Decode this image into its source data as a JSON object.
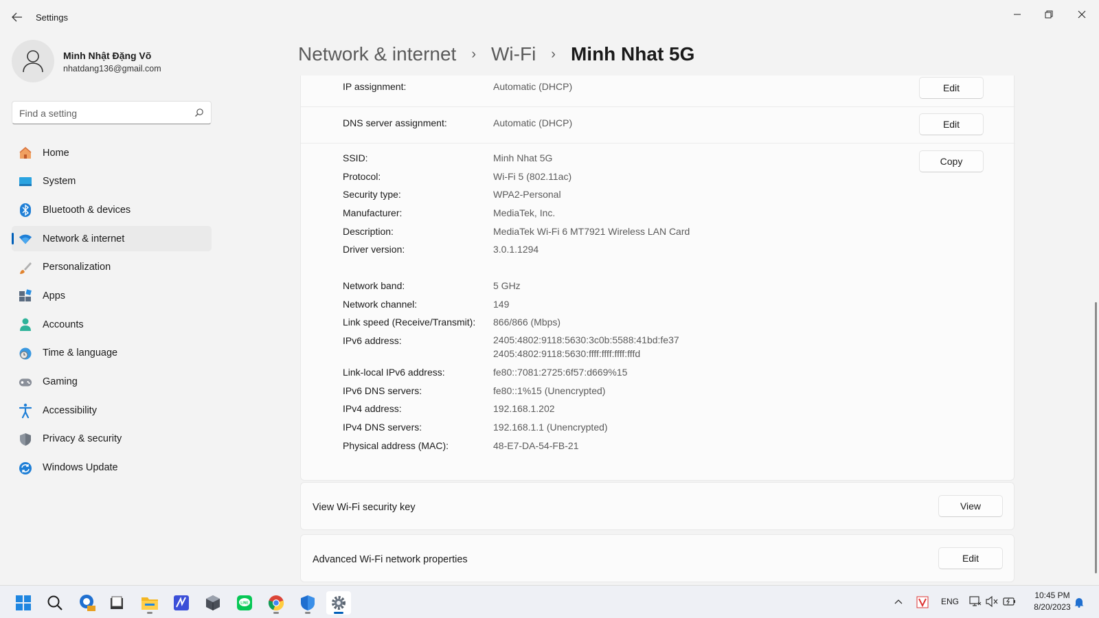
{
  "window": {
    "title": "Settings",
    "back_icon": "back-arrow-icon",
    "controls": [
      "minimize",
      "restore",
      "close"
    ]
  },
  "user": {
    "name": "Minh Nhật Đặng Võ",
    "email": "nhatdang136@gmail.com"
  },
  "search": {
    "placeholder": "Find a setting"
  },
  "sidebar": {
    "items": [
      {
        "label": "Home",
        "icon": "home-icon"
      },
      {
        "label": "System",
        "icon": "system-icon"
      },
      {
        "label": "Bluetooth & devices",
        "icon": "bluetooth-icon"
      },
      {
        "label": "Network & internet",
        "icon": "wifi-icon",
        "active": true
      },
      {
        "label": "Personalization",
        "icon": "brush-icon"
      },
      {
        "label": "Apps",
        "icon": "apps-icon"
      },
      {
        "label": "Accounts",
        "icon": "accounts-icon"
      },
      {
        "label": "Time & language",
        "icon": "globe-clock-icon"
      },
      {
        "label": "Gaming",
        "icon": "gamepad-icon"
      },
      {
        "label": "Accessibility",
        "icon": "accessibility-icon"
      },
      {
        "label": "Privacy & security",
        "icon": "shield-icon"
      },
      {
        "label": "Windows Update",
        "icon": "update-icon"
      }
    ]
  },
  "breadcrumb": {
    "items": [
      "Network & internet",
      "Wi-Fi",
      "Minh Nhat 5G"
    ],
    "separator": "›"
  },
  "assignments": [
    {
      "label": "IP assignment:",
      "value": "Automatic (DHCP)",
      "button": "Edit"
    },
    {
      "label": "DNS server assignment:",
      "value": "Automatic (DHCP)",
      "button": "Edit"
    }
  ],
  "properties": {
    "copy_button": "Copy",
    "rows": [
      {
        "label": "SSID:",
        "value": "Minh Nhat 5G"
      },
      {
        "label": "Protocol:",
        "value": "Wi-Fi 5 (802.11ac)"
      },
      {
        "label": "Security type:",
        "value": "WPA2-Personal"
      },
      {
        "label": "Manufacturer:",
        "value": "MediaTek, Inc."
      },
      {
        "label": "Description:",
        "value": "MediaTek Wi-Fi 6 MT7921 Wireless LAN Card"
      },
      {
        "label": "Driver version:",
        "value": "3.0.1.1294"
      },
      {
        "label": "Network band:",
        "value": "5 GHz"
      },
      {
        "label": "Network channel:",
        "value": "149"
      },
      {
        "label": "Link speed (Receive/Transmit):",
        "value": "866/866 (Mbps)"
      },
      {
        "label": "IPv6 address:",
        "value": "2405:4802:9118:5630:3c0b:5588:41bd:fe37",
        "value2": "2405:4802:9118:5630:ffff:ffff:ffff:fffd"
      },
      {
        "label": "Link-local IPv6 address:",
        "value": "fe80::7081:2725:6f57:d669%15"
      },
      {
        "label": "IPv6 DNS servers:",
        "value": "fe80::1%15 (Unencrypted)"
      },
      {
        "label": "IPv4 address:",
        "value": "192.168.1.202"
      },
      {
        "label": "IPv4 DNS servers:",
        "value": "192.168.1.1 (Unencrypted)"
      },
      {
        "label": "Physical address (MAC):",
        "value": "48-E7-DA-54-FB-21"
      }
    ]
  },
  "security_key": {
    "label": "View Wi-Fi security key",
    "button": "View"
  },
  "advanced": {
    "label": "Advanced Wi-Fi network properties",
    "button": "Edit"
  },
  "taskbar": {
    "apps": [
      "start-icon",
      "search-icon",
      "pdf-viewer-icon",
      "notepad-icon",
      "file-explorer-icon",
      "editor-icon",
      "3d-cube-icon",
      "line-chat-icon",
      "chrome-icon",
      "defender-icon",
      "settings-icon"
    ],
    "tray": {
      "language": "ENG",
      "time": "10:45 PM",
      "date": "8/20/2023"
    }
  },
  "colors": {
    "accent": "#005fb8",
    "background": "#f3f3f3",
    "card": "#fbfbfb"
  }
}
